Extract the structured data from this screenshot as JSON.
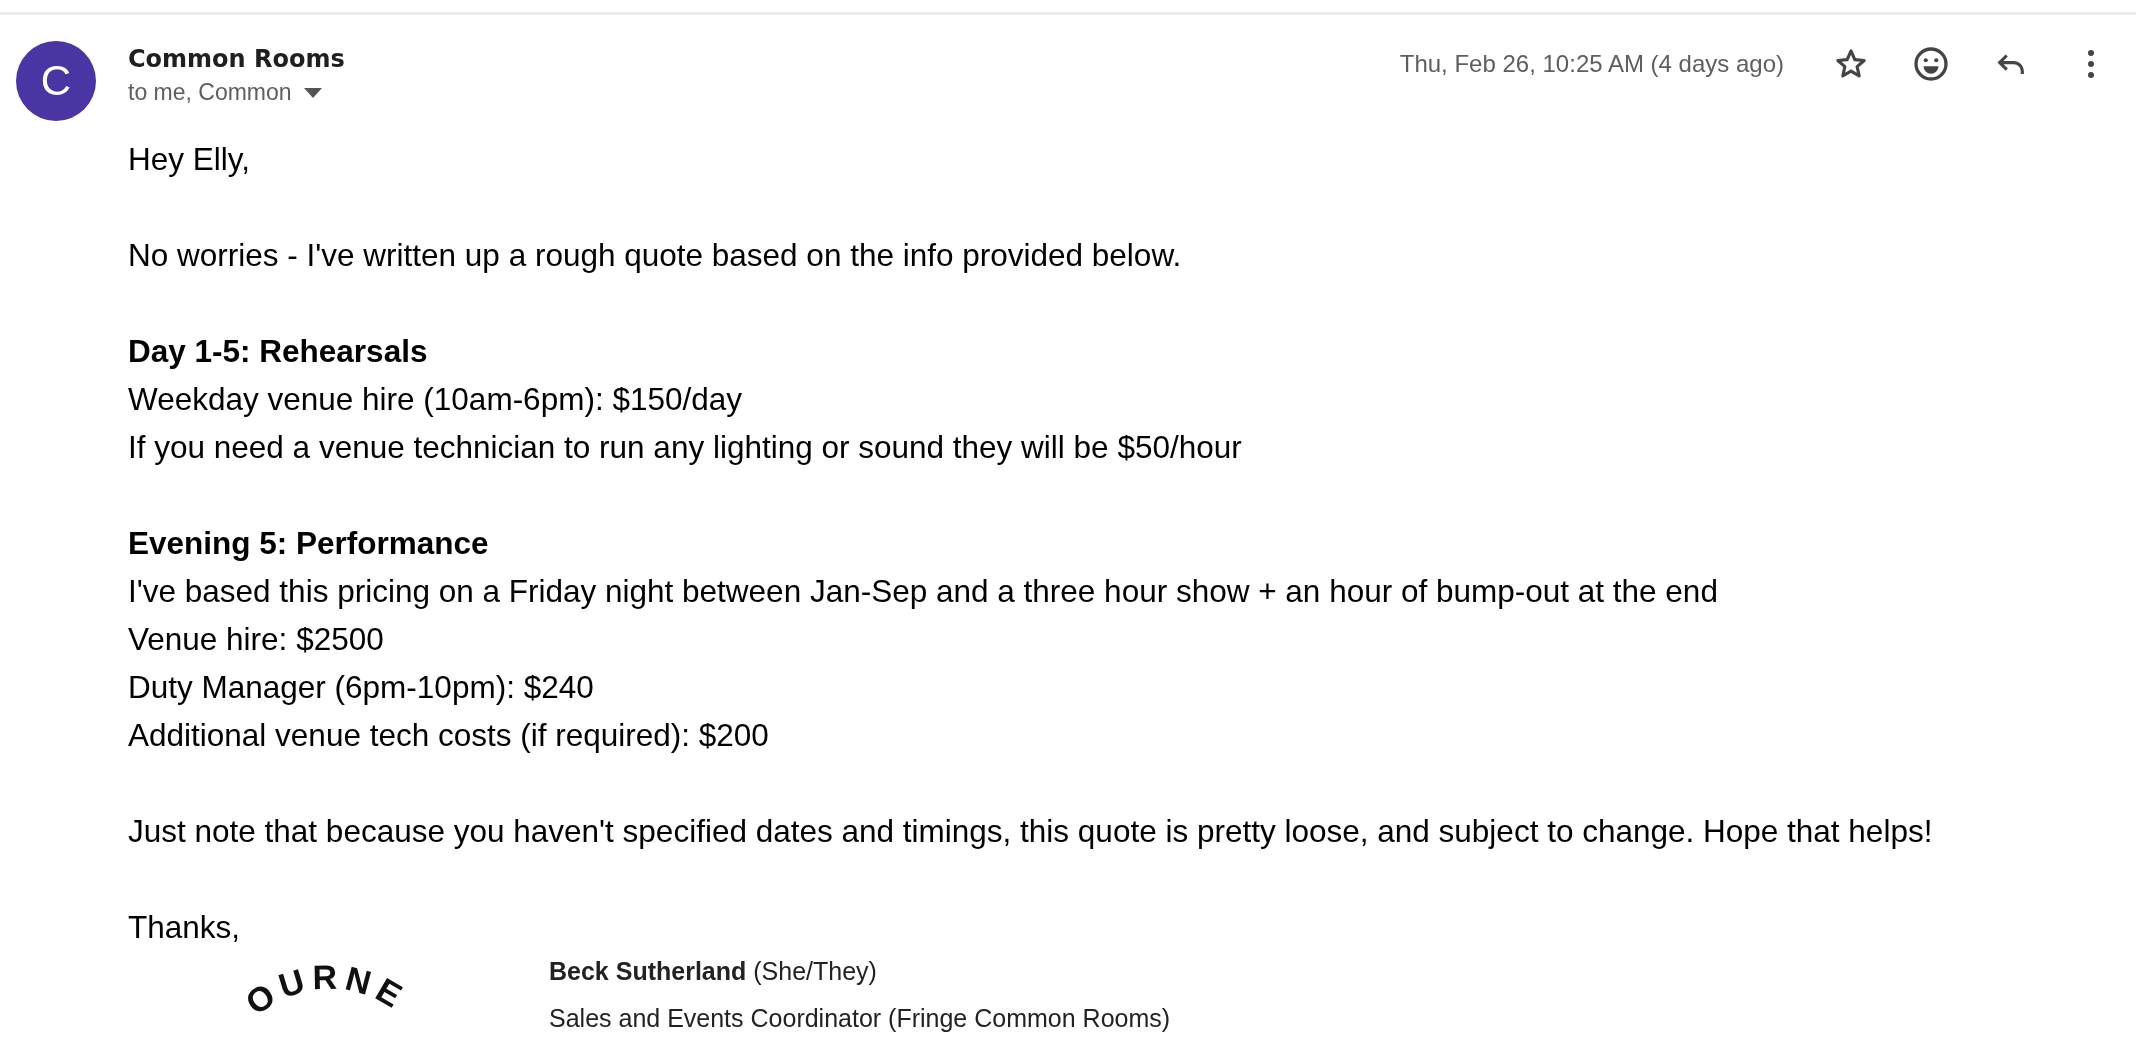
{
  "sender": {
    "initial": "C",
    "name": "Common Rooms",
    "recipients": "to me, Common"
  },
  "date": "Thu, Feb 26, 10:25 AM (4 days ago)",
  "body": [
    {
      "lines": [
        {
          "text": "Hey Elly,",
          "bold": false
        }
      ]
    },
    {
      "lines": [
        {
          "text": "No worries - I've written up a rough quote based on the info provided below.",
          "bold": false
        }
      ]
    },
    {
      "lines": [
        {
          "text": "Day 1-5: Rehearsals",
          "bold": true
        },
        {
          "text": "Weekday venue hire (10am-6pm): $150/day",
          "bold": false
        },
        {
          "text": "If you need a venue technician to run any lighting or sound they will be $50/hour",
          "bold": false
        }
      ]
    },
    {
      "lines": [
        {
          "text": "Evening 5: Performance",
          "bold": true
        },
        {
          "text": "I've based this pricing on a Friday night between Jan-Sep and a three hour show + an hour of bump-out at the end",
          "bold": false
        },
        {
          "text": "Venue hire: $2500",
          "bold": false
        },
        {
          "text": "Duty Manager (6pm-10pm): $240",
          "bold": false
        },
        {
          "text": "Additional venue tech costs (if required): $200",
          "bold": false
        }
      ]
    },
    {
      "lines": [
        {
          "text": "Just note that because you haven't specified dates and timings, this quote is pretty loose, and subject to change. Hope that helps!",
          "bold": false
        }
      ]
    },
    {
      "lines": [
        {
          "text": "Thanks,",
          "bold": false
        }
      ]
    }
  ],
  "signature": {
    "logo_text": "OURNE",
    "lines": [
      "**Beck Sutherland** (She/They)",
      "Sales and Events Coordinator (Fringe Common Rooms)"
    ]
  }
}
